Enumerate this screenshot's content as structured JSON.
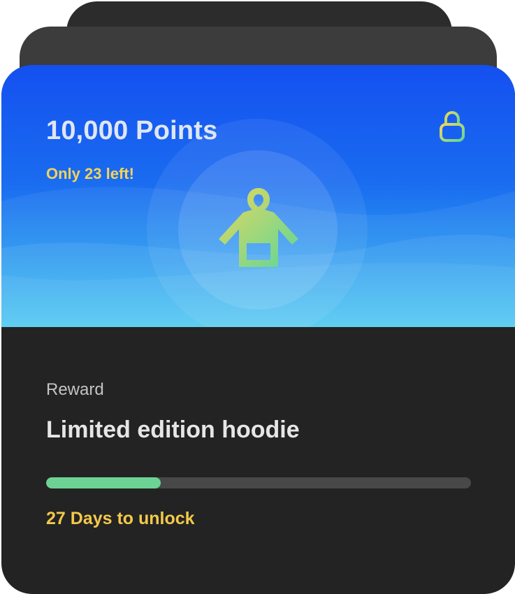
{
  "reward": {
    "points_title": "10,000 Points",
    "stock_note": "Only 23 left!",
    "section_label": "Reward",
    "name": "Limited edition hoodie",
    "unlock_text": "27 Days to unlock",
    "progress_fraction": 0.27,
    "icons": {
      "lock": "lock-icon",
      "item": "hoodie-icon"
    }
  },
  "colors": {
    "hero_top": "#1450f0",
    "hero_bottom": "#3fc4f2",
    "card_background": "#232323",
    "points_text": "#dfe6f3",
    "stock_note": "#f3d35a",
    "progress_fill": "#6cd394",
    "progress_track": "#484848",
    "unlock_text": "#f3c94a"
  }
}
